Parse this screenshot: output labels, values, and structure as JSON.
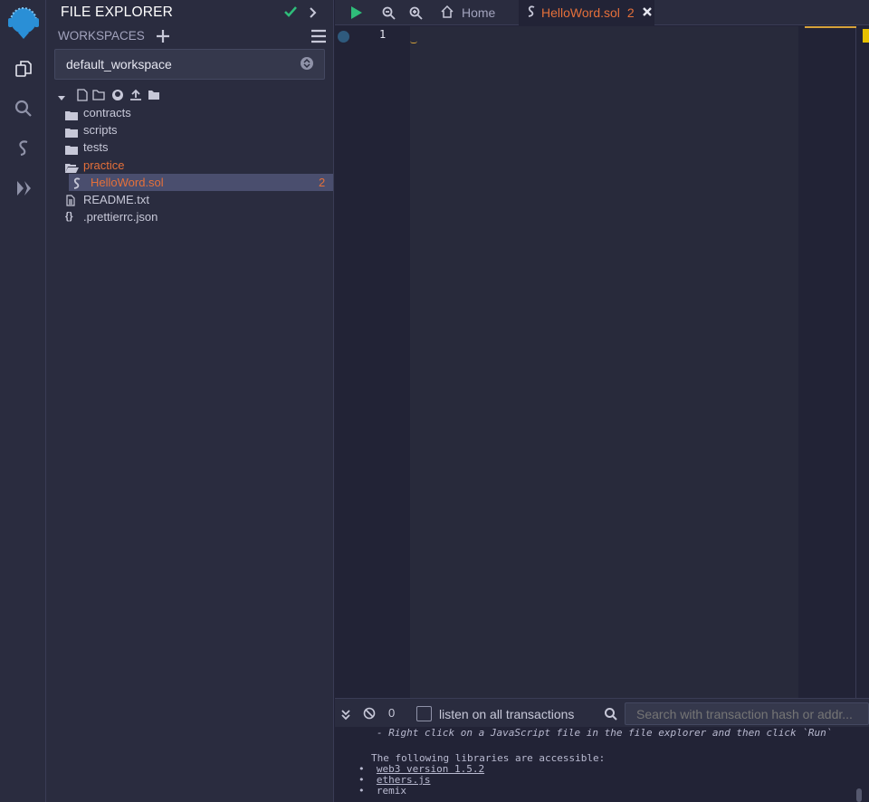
{
  "sidepanel": {
    "title": "FILE EXPLORER",
    "workspaces_label": "WORKSPACES",
    "workspace_selected": "default_workspace",
    "tree": {
      "contracts": "contracts",
      "scripts": "scripts",
      "tests": "tests",
      "practice": "practice",
      "helloword": "HelloWord.sol",
      "helloword_badge": "2",
      "readme": "README.txt",
      "prettierrc": ".prettierrc.json"
    }
  },
  "tabs": {
    "home": "Home",
    "file": "HelloWord.sol",
    "file_badge": "2"
  },
  "editor": {
    "line_number": "1"
  },
  "terminal": {
    "tx_count": "0",
    "listen_label": "listen on all transactions",
    "search_placeholder": "Search with transaction hash or addr...",
    "lines": {
      "hint": "- Right click on a JavaScript file in the file explorer and then click `Run`",
      "libs_header": "The following libraries are accessible:",
      "lib1": "web3 version 1.5.2",
      "lib2": "ethers.js",
      "lib3": "remix"
    }
  },
  "colors": {
    "accent_orange": "#e5703a",
    "accent_green": "#2fbd7a",
    "remix_blue": "#2a8fd6"
  }
}
